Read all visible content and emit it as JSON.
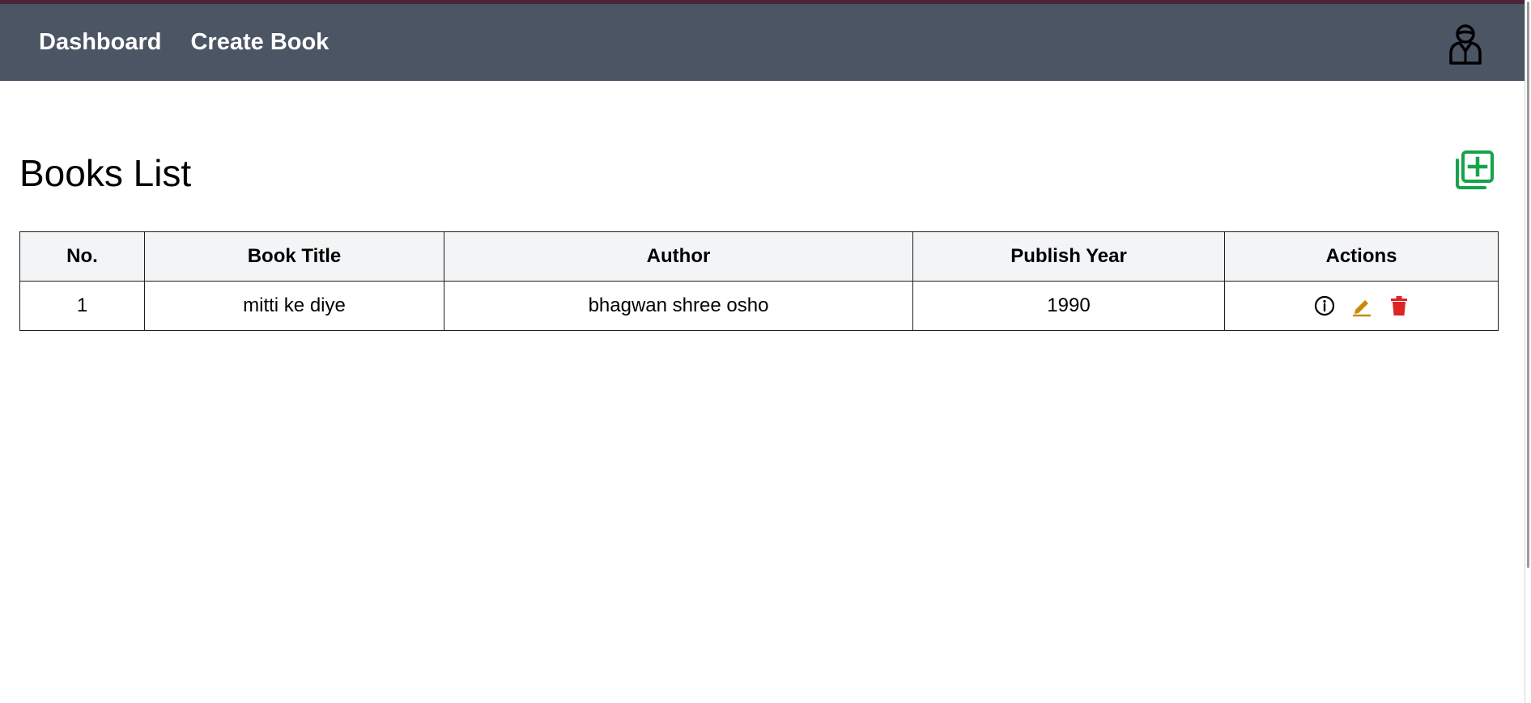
{
  "nav": {
    "links": [
      {
        "label": "Dashboard"
      },
      {
        "label": "Create Book"
      }
    ],
    "profile_icon": "user-avatar-icon"
  },
  "main": {
    "title": "Books List",
    "add_icon": "add-square-icon"
  },
  "table": {
    "headers": [
      "No.",
      "Book Title",
      "Author",
      "Publish Year",
      "Actions"
    ],
    "rows": [
      {
        "no": "1",
        "title": "mitti ke diye",
        "author": "bhagwan shree osho",
        "year": "1990",
        "actions": [
          "info-icon",
          "edit-icon",
          "delete-icon"
        ]
      }
    ]
  },
  "colors": {
    "navbar": "#4b5563",
    "top_strip": "#4b2437",
    "header_row": "#f3f4f6",
    "add_button": "#16a34a",
    "edit_icon": "#ca8a04",
    "delete_icon": "#dc2626"
  }
}
